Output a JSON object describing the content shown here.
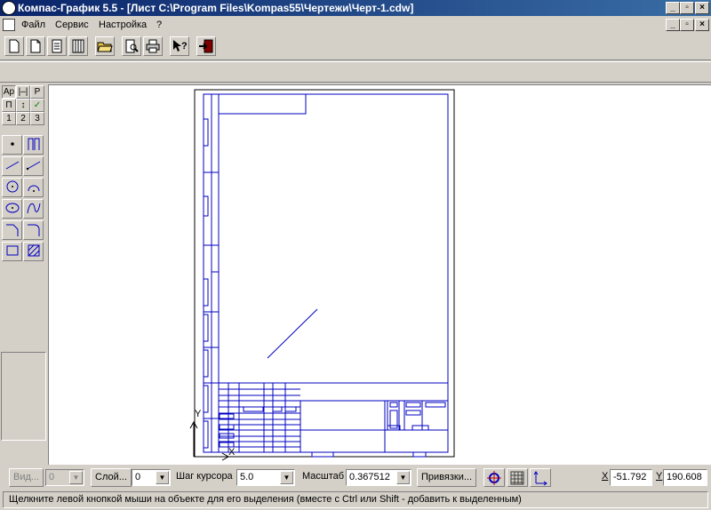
{
  "window": {
    "title": "Компас-График 5.5 - [Лист C:\\Program Files\\Kompas55\\Чертежи\\Черт-1.cdw]",
    "controls": [
      "_",
      "▫",
      "×"
    ]
  },
  "menu": {
    "items": [
      "Файл",
      "Сервис",
      "Настройка",
      "?"
    ]
  },
  "toolbar": {
    "icons": [
      "new-sheet-icon",
      "new-fragment-icon",
      "new-text-document-icon",
      "new-spec-icon",
      "open-folder-icon",
      "preview-icon",
      "print-icon",
      "help-pointer-icon",
      "exit-icon"
    ]
  },
  "left_panel": {
    "small_buttons": [
      "Ар",
      "|–|",
      "Р",
      "П",
      "↕",
      "✓",
      "1",
      "2",
      "3"
    ],
    "tools": [
      "point-icon",
      "aux-line-icon",
      "segment-icon",
      "parallel-segment-icon",
      "circle-icon",
      "arc-icon",
      "ellipse-icon",
      "spline-icon",
      "chamfer-icon",
      "fillet-icon",
      "rectangle-icon",
      "hatch-icon"
    ]
  },
  "drawing": {
    "axis_x": "X",
    "axis_y": "Y"
  },
  "status": {
    "view_button": "Вид...",
    "view_value": "0",
    "layer_button": "Слой...",
    "layer_value": "0",
    "step_label": "Шаг курсора",
    "step_value": "5.0",
    "scale_label": "Масштаб",
    "scale_value": "0.367512",
    "snap_button": "Привязки...",
    "x_label": "X",
    "x_value": "-51.792",
    "y_label": "Y",
    "y_value": "190.608"
  },
  "hint": "Щелкните левой кнопкой мыши на объекте для его выделения (вместе с Ctrl или Shift - добавить к выделенным)"
}
